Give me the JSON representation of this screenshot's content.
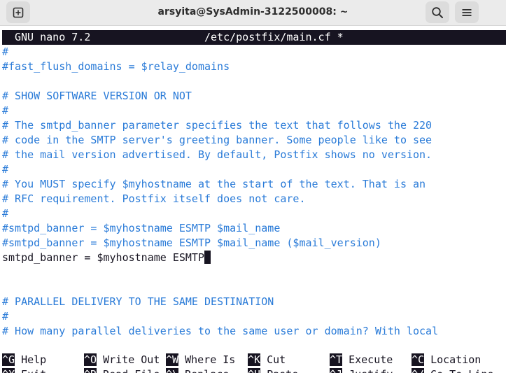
{
  "window": {
    "title": "arsyita@SysAdmin-3122500008: ~"
  },
  "nano": {
    "version": "GNU nano 7.2",
    "filename": "/etc/postfix/main.cf *"
  },
  "lines": [
    {
      "text": "#",
      "type": "comment"
    },
    {
      "text": "#fast_flush_domains = $relay_domains",
      "type": "comment"
    },
    {
      "text": "",
      "type": "plain"
    },
    {
      "text": "# SHOW SOFTWARE VERSION OR NOT",
      "type": "comment"
    },
    {
      "text": "#",
      "type": "comment"
    },
    {
      "text": "# The smtpd_banner parameter specifies the text that follows the 220",
      "type": "comment"
    },
    {
      "text": "# code in the SMTP server's greeting banner. Some people like to see",
      "type": "comment"
    },
    {
      "text": "# the mail version advertised. By default, Postfix shows no version.",
      "type": "comment"
    },
    {
      "text": "#",
      "type": "comment"
    },
    {
      "text": "# You MUST specify $myhostname at the start of the text. That is an",
      "type": "comment"
    },
    {
      "text": "# RFC requirement. Postfix itself does not care.",
      "type": "comment"
    },
    {
      "text": "#",
      "type": "comment"
    },
    {
      "text": "#smtpd_banner = $myhostname ESMTP $mail_name",
      "type": "comment"
    },
    {
      "text": "#smtpd_banner = $myhostname ESMTP $mail_name ($mail_version)",
      "type": "comment"
    },
    {
      "text": "smtpd_banner = $myhostname ESMTP",
      "type": "plain",
      "cursor": true
    },
    {
      "text": "",
      "type": "plain"
    },
    {
      "text": "",
      "type": "plain"
    },
    {
      "text": "# PARALLEL DELIVERY TO THE SAME DESTINATION",
      "type": "comment"
    },
    {
      "text": "#",
      "type": "comment"
    },
    {
      "text": "# How many parallel deliveries to the same user or domain? With local",
      "type": "comment"
    }
  ],
  "shortcuts": [
    {
      "key": "^G",
      "label": "Help"
    },
    {
      "key": "^O",
      "label": "Write Out"
    },
    {
      "key": "^W",
      "label": "Where Is"
    },
    {
      "key": "^K",
      "label": "Cut"
    },
    {
      "key": "^T",
      "label": "Execute"
    },
    {
      "key": "^C",
      "label": "Location"
    }
  ],
  "shortcuts_row2": [
    {
      "key": "^X",
      "label": "Exit"
    },
    {
      "key": "^R",
      "label": "Read File"
    },
    {
      "key": "^\\",
      "label": "Replace"
    },
    {
      "key": "^U",
      "label": "Paste"
    },
    {
      "key": "^J",
      "label": "Justify"
    },
    {
      "key": "^/",
      "label": "Go To Line"
    }
  ],
  "icons": {
    "new_tab": "new-tab-icon",
    "search": "search-icon",
    "menu": "hamburger-menu-icon"
  }
}
